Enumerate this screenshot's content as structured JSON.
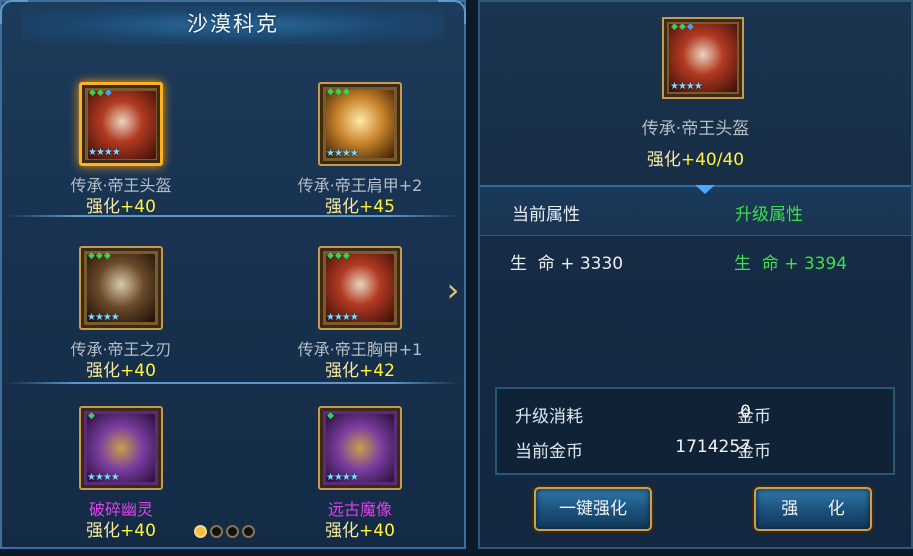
{
  "left_panel": {
    "title": "沙漠科克",
    "items": [
      {
        "name": "传承·帝王头盔",
        "enh_label": "强化",
        "enh_value": "+40",
        "icon": "helmet-icon",
        "selected": true,
        "quality": "gold"
      },
      {
        "name": "传承·帝王肩甲+2",
        "enh_label": "强化",
        "enh_value": "+45",
        "icon": "shoulder-armor-icon",
        "selected": false,
        "quality": "gold"
      },
      {
        "name": "传承·帝王之刃",
        "enh_label": "强化",
        "enh_value": "+40",
        "icon": "blade-icon",
        "selected": false,
        "quality": "gold"
      },
      {
        "name": "传承·帝王胸甲+1",
        "enh_label": "强化",
        "enh_value": "+42",
        "icon": "chest-armor-icon",
        "selected": false,
        "quality": "gold"
      },
      {
        "name": "破碎幽灵",
        "enh_label": "强化",
        "enh_value": "+40",
        "icon": "necklace-icon",
        "selected": false,
        "quality": "purple"
      },
      {
        "name": "远古魔像",
        "enh_label": "强化",
        "enh_value": "+40",
        "icon": "ring-icon",
        "selected": false,
        "quality": "purple"
      }
    ],
    "page_dots": {
      "count": 4,
      "active": 1
    }
  },
  "detail": {
    "name": "传承·帝王头盔",
    "enh_label": "强化",
    "enh_value": "+40/40",
    "icon": "helmet-icon"
  },
  "tabs": {
    "current": "当前属性",
    "upgrade": "升级属性"
  },
  "stats": {
    "current": "生  命 + 3330",
    "upgrade": "生  命 + 3394"
  },
  "cost": {
    "upgrade_cost_label": "升级消耗",
    "upgrade_cost_value": "0",
    "current_gold_label": "当前金币",
    "current_gold_value": "1714257",
    "unit": "金币"
  },
  "buttons": {
    "one_click": "一键强化",
    "enhance": "强 化"
  },
  "colors": {
    "enhance_value": "#fff43a",
    "upgrade_green": "#3be04a",
    "purple_name": "#e040e8",
    "selected_border": "#ffb21e"
  }
}
